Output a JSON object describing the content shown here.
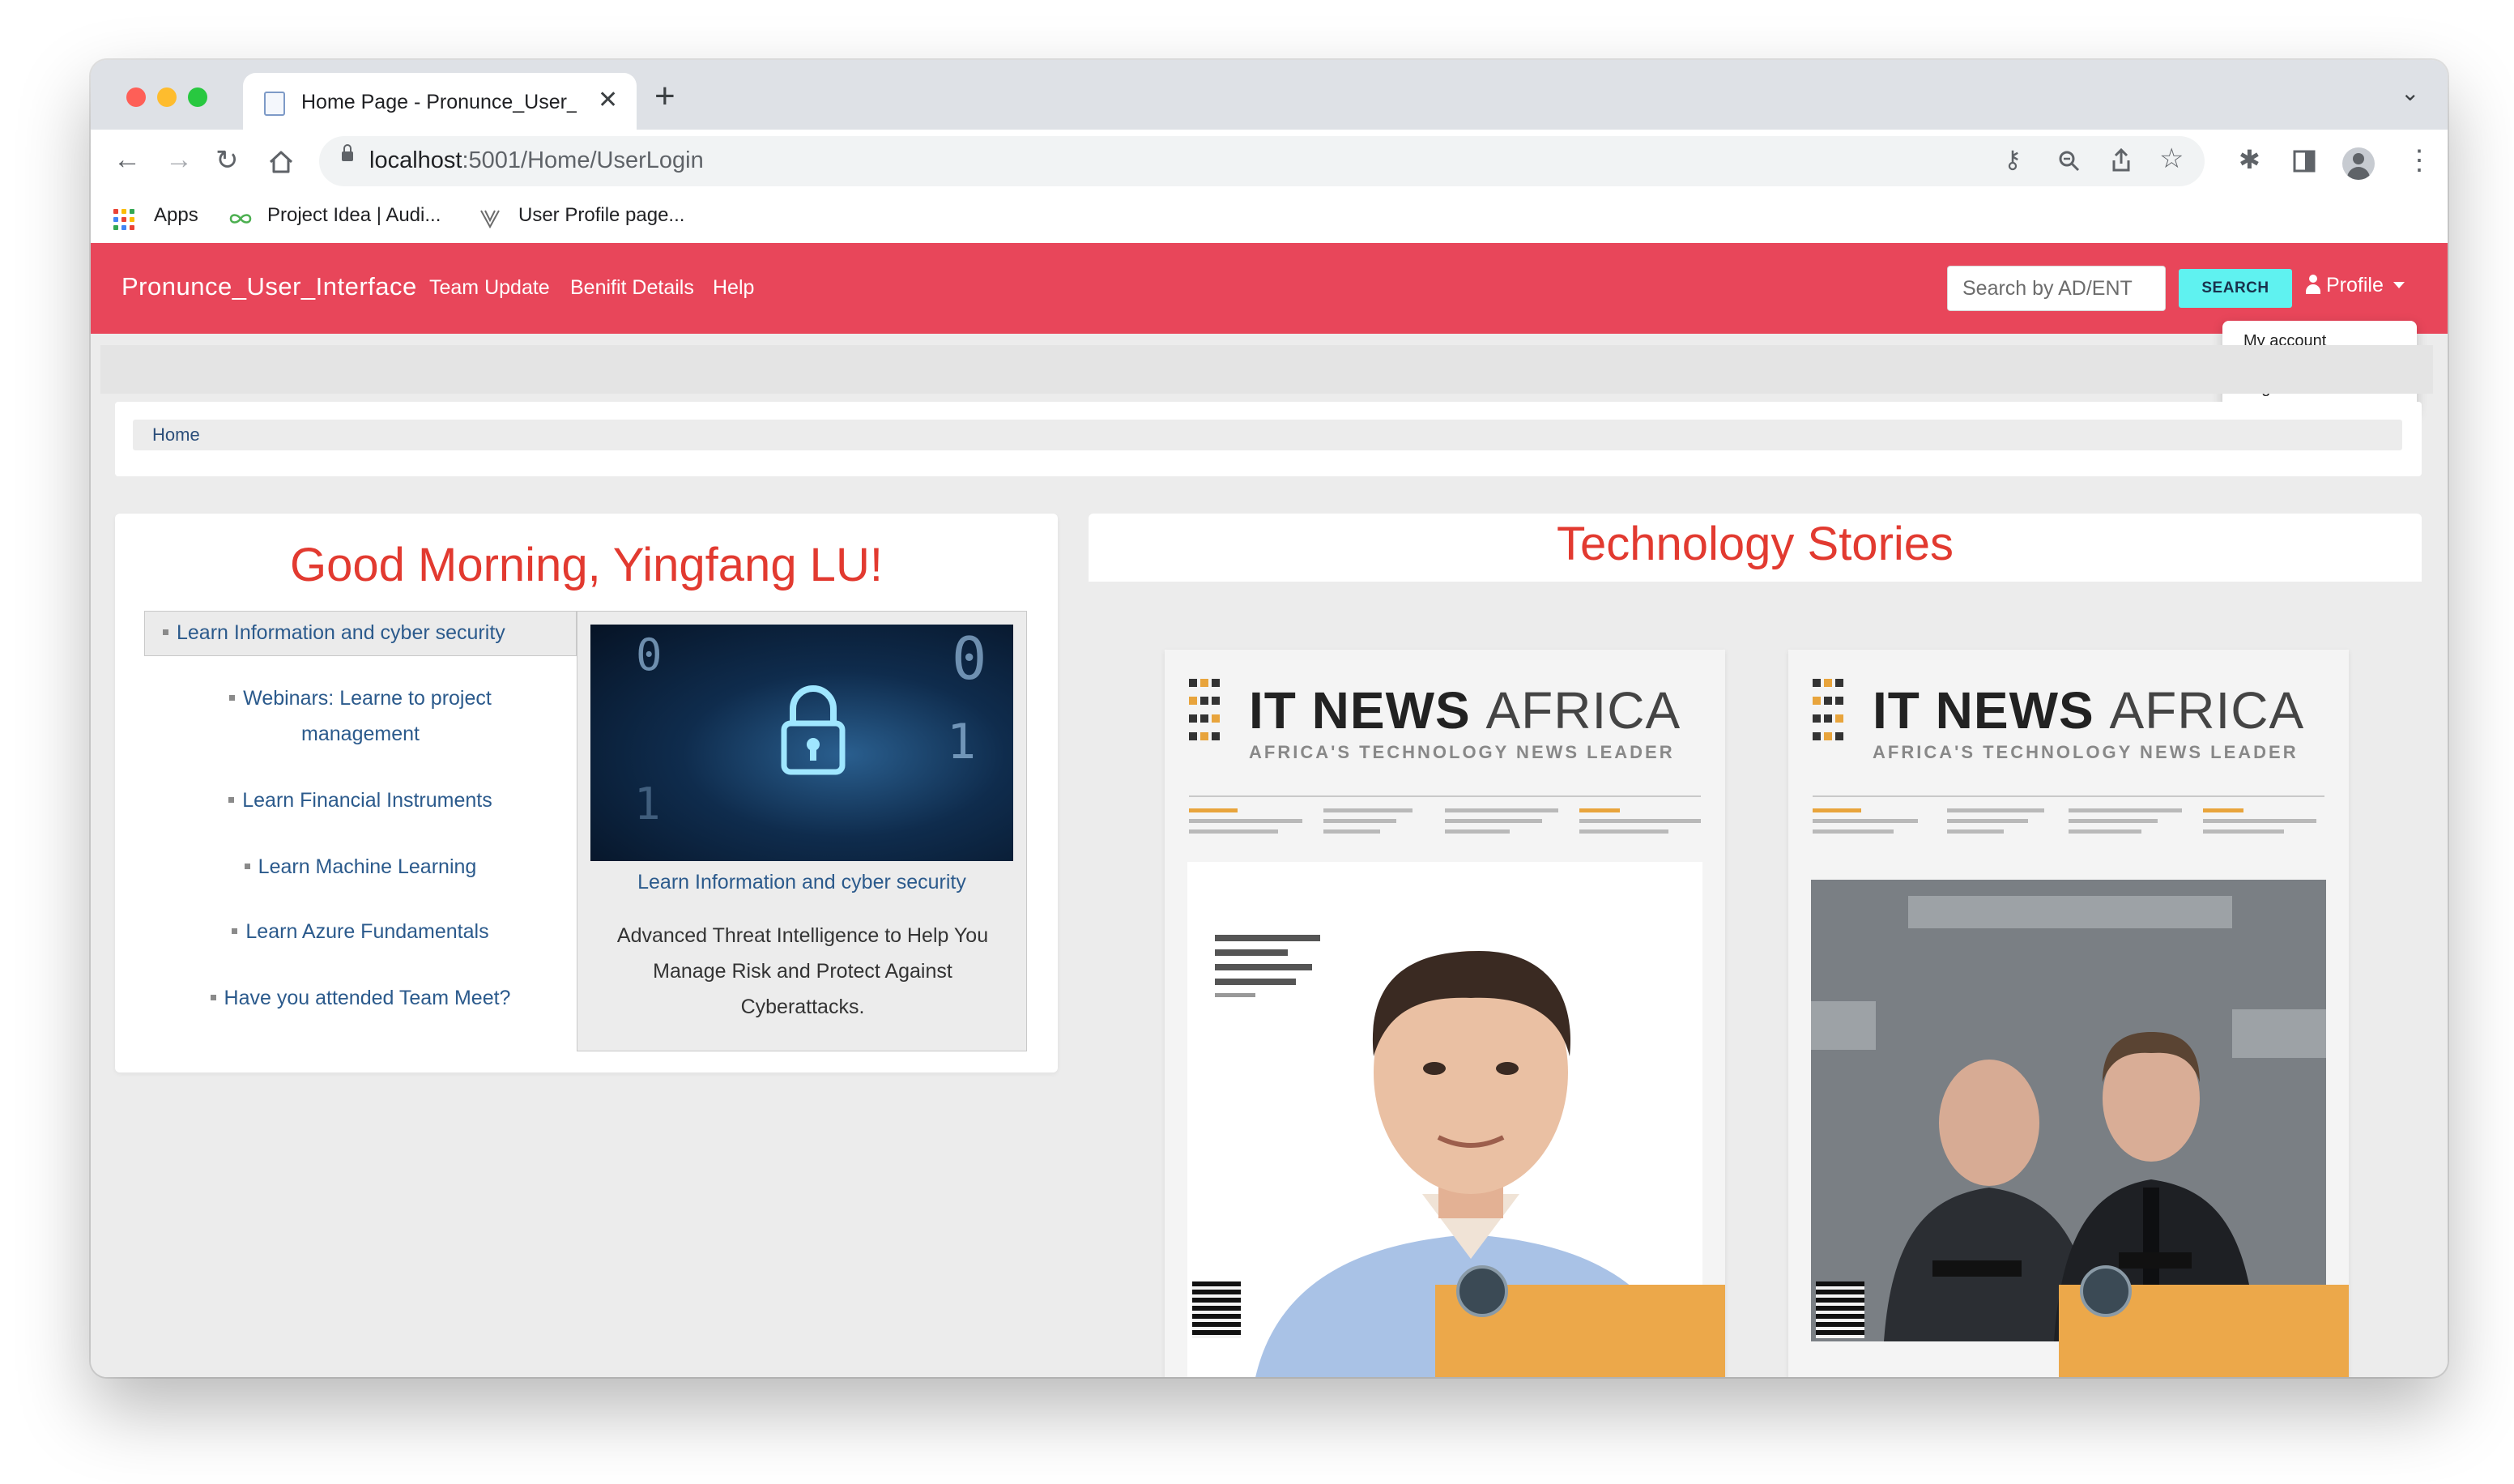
{
  "browser": {
    "tab_title": "Home Page - Pronunce_User_I",
    "tab_close": "✕",
    "new_tab": "+",
    "tabs_menu": "⌄",
    "url_host": "localhost",
    "url_path": ":5001/Home/UserLogin",
    "bookmarks": [
      {
        "label": "Apps"
      },
      {
        "label": "Project Idea | Audi..."
      },
      {
        "label": "User Profile page..."
      }
    ]
  },
  "navbar": {
    "brand": "Pronunce_User_Interface",
    "links": [
      "Team Update",
      "Benifit Details",
      "Help"
    ],
    "search_placeholder": "Search by AD/ENT",
    "search_button": "SEARCH",
    "profile": "Profile",
    "dropdown": [
      "My account",
      "Log out"
    ]
  },
  "breadcrumb": "Home",
  "greeting": {
    "title": "Good Morning, Yingfang LU!",
    "active_item": "Learn Information and cyber security",
    "items": [
      "Webinars: Learne to project management",
      "Learn Financial Instruments",
      "Learn Machine Learning",
      "Learn Azure Fundamentals",
      "Have you attended Team Meet?"
    ],
    "detail": {
      "title": "Learn Information and cyber security",
      "description": "Advanced Threat Intelligence to Help You Manage Risk and Protect Against Cyberattacks."
    }
  },
  "stories": {
    "title": "Technology Stories",
    "magazines": [
      {
        "name_bold": "IT NEWS",
        "name_light": "AFRICA",
        "tagline": "AFRICA'S TECHNOLOGY NEWS LEADER"
      },
      {
        "name_bold": "IT NEWS",
        "name_light": "AFRICA",
        "tagline": "AFRICA'S TECHNOLOGY NEWS LEADER"
      }
    ]
  },
  "colors": {
    "navbar": "#e8465a",
    "heading": "#e23a30",
    "link": "#2b5a8c",
    "search_button": "#5ff2f0"
  }
}
